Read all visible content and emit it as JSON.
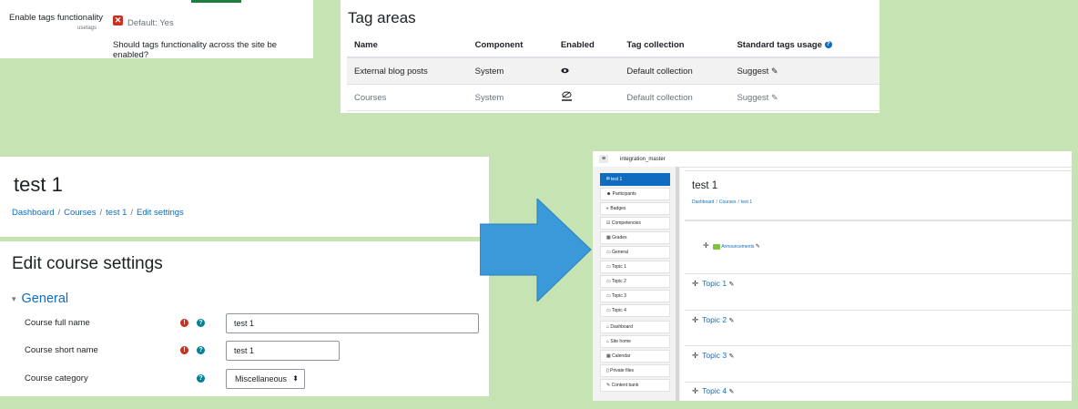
{
  "setting": {
    "label": "Enable tags functionality",
    "name": "usetags",
    "default_text": "Default: Yes",
    "description": "Should tags functionality across the site be enabled?"
  },
  "tag_areas": {
    "title": "Tag areas",
    "columns": [
      "Name",
      "Component",
      "Enabled",
      "Tag collection",
      "Standard tags usage"
    ],
    "rows": [
      {
        "name": "External blog posts",
        "component": "System",
        "tag_collection": "Default collection",
        "usage": "Suggest"
      },
      {
        "name": "Courses",
        "component": "System",
        "tag_collection": "Default collection",
        "usage": "Suggest"
      }
    ]
  },
  "course_header": {
    "title": "test 1",
    "breadcrumb": [
      "Dashboard",
      "Courses",
      "test 1",
      "Edit settings"
    ]
  },
  "edit_form": {
    "title": "Edit course settings",
    "section": "General",
    "fields": [
      {
        "label": "Course full name",
        "value": "test 1"
      },
      {
        "label": "Course short name",
        "value": "test 1"
      },
      {
        "label": "Course category",
        "value": "Miscellaneous"
      }
    ]
  },
  "course_page": {
    "site_name": "integration_master",
    "title": "test 1",
    "breadcrumb": [
      "Dashboard",
      "Courses",
      "test 1"
    ],
    "nav": [
      "test 1",
      "Participants",
      "Badges",
      "Competencies",
      "Grades",
      "General",
      "Topic 1",
      "Topic 2",
      "Topic 3",
      "Topic 4",
      "Dashboard",
      "Site home",
      "Calendar",
      "Private files",
      "Content bank"
    ],
    "announcements": "Announcements",
    "topics": [
      "Topic 1",
      "Topic 2",
      "Topic 3",
      "Topic 4"
    ]
  },
  "colors": {
    "background": "#c6e3b3",
    "link": "#0f6cbf",
    "arrow": "#3a9ad9",
    "required": "#ca3120",
    "help": "#008196"
  }
}
